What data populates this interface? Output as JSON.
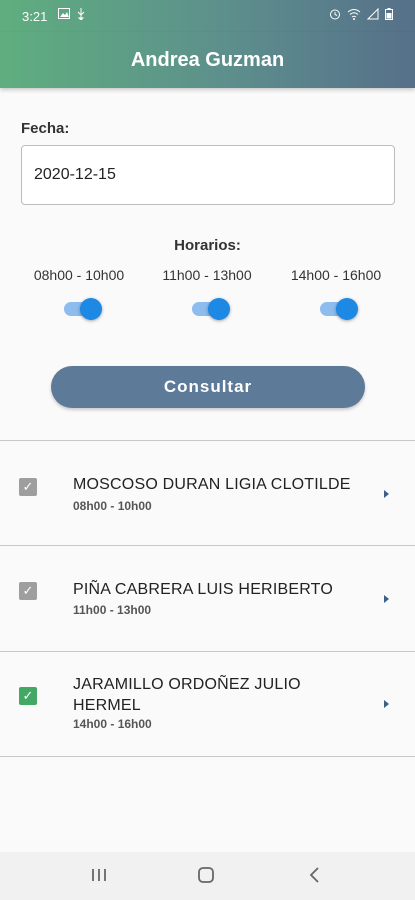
{
  "status_bar": {
    "time": "3:21"
  },
  "app_bar": {
    "title": "Andrea Guzman"
  },
  "form": {
    "fecha_label": "Fecha:",
    "fecha_value": "2020-12-15",
    "horarios_label": "Horarios:",
    "slots": [
      {
        "label": "08h00 - 10h00",
        "enabled": true
      },
      {
        "label": "11h00 - 13h00",
        "enabled": true
      },
      {
        "label": "14h00 - 16h00",
        "enabled": true
      }
    ],
    "consultar_label": "Consultar"
  },
  "results": [
    {
      "name": "MOSCOSO DURAN LIGIA CLOTILDE",
      "time": "08h00 - 10h00",
      "checked": true,
      "check_color": "#9e9e9e"
    },
    {
      "name": "PIÑA CABRERA LUIS HERIBERTO",
      "time": "11h00 - 13h00",
      "checked": true,
      "check_color": "#9e9e9e"
    },
    {
      "name": "JARAMILLO ORDOÑEZ JULIO HERMEL",
      "time": "14h00 - 16h00",
      "checked": true,
      "check_color": "#43a863"
    }
  ],
  "colors": {
    "header_gradient_start": "#5fae7f",
    "header_gradient_end": "#56708a",
    "button": "#5d7a98",
    "switch_active": "#1e88e5",
    "chevron": "#3b5f86"
  }
}
